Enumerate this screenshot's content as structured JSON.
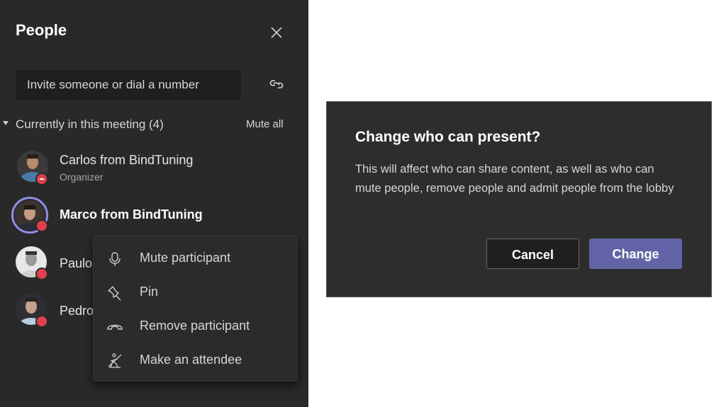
{
  "people_panel": {
    "title": "People",
    "close_icon": "close-icon",
    "invite_placeholder": "Invite someone or dial a number",
    "share_link_icon": "link-icon",
    "section": {
      "label": "Currently in this meeting (4)",
      "mute_all_label": "Mute all"
    },
    "participants": [
      {
        "name": "Carlos from BindTuning",
        "role": "Organizer",
        "status": "do-not-disturb"
      },
      {
        "name": "Marco from BindTuning",
        "role": "",
        "status": "busy",
        "selected": true
      },
      {
        "name": "Paulo",
        "role": "",
        "status": "busy"
      },
      {
        "name": "Pedro",
        "role": "",
        "status": "busy"
      }
    ]
  },
  "context_menu": {
    "items": [
      {
        "label": "Mute participant",
        "icon": "microphone-icon"
      },
      {
        "label": "Pin",
        "icon": "pin-icon"
      },
      {
        "label": "Remove participant",
        "icon": "hang-up-icon"
      },
      {
        "label": "Make an attendee",
        "icon": "attendee-icon"
      }
    ]
  },
  "dialog": {
    "title": "Change who can present?",
    "body": "This will affect who can share content, as well as who can mute people, remove people and admit people from the lobby",
    "cancel_label": "Cancel",
    "confirm_label": "Change"
  },
  "colors": {
    "panel_bg": "#292929",
    "accent": "#6264a7",
    "status_busy": "#e0404e",
    "selected_ring": "#8f8fe6"
  }
}
